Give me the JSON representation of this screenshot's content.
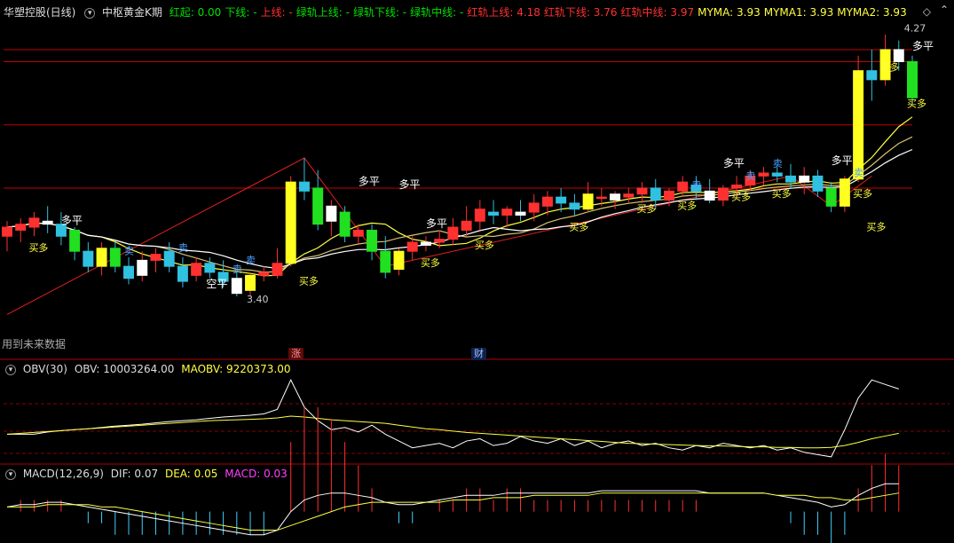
{
  "main_header": {
    "stock_name": "华塑控股(日线)",
    "indicator_name": "中枢黄金K期",
    "items": [
      {
        "label": "红起:",
        "value": "0.00",
        "color": "#00e000"
      },
      {
        "label": "下线:",
        "value": "-",
        "color": "#00e000"
      },
      {
        "label": "上线:",
        "value": "-",
        "color": "#ff3030"
      },
      {
        "label": "绿轨上线:",
        "value": "-",
        "color": "#00e000"
      },
      {
        "label": "绿轨下线:",
        "value": "-",
        "color": "#00e000"
      },
      {
        "label": "绿轨中线:",
        "value": "-",
        "color": "#00e000"
      },
      {
        "label": "红轨上线:",
        "value": "4.18",
        "color": "#ff3030"
      },
      {
        "label": "红轨下线:",
        "value": "3.76",
        "color": "#ff3030"
      },
      {
        "label": "红轨中线:",
        "value": "3.97",
        "color": "#ff3030"
      },
      {
        "label": "MYMA:",
        "value": "3.93",
        "color": "#ffff40"
      },
      {
        "label": "MYMA1:",
        "value": "3.93",
        "color": "#ffff40"
      },
      {
        "label": "MYMA2:",
        "value": "3.93",
        "color": "#ffff40"
      }
    ]
  },
  "main_footer": {
    "note": "用到未来数据",
    "tag_zhang": "涨",
    "tag_cai": "财"
  },
  "obv_header": {
    "name": "OBV(30)",
    "obv_label": "OBV:",
    "obv_value": "10003264.00",
    "maobv_label": "MAOBV:",
    "maobv_value": "9220373.00"
  },
  "macd_header": {
    "name": "MACD(12,26,9)",
    "dif_label": "DIF:",
    "dif_value": "0.07",
    "dea_label": "DEA:",
    "dea_value": "0.05",
    "macd_label": "MACD:",
    "macd_value": "0.03"
  },
  "chart_data": [
    {
      "type": "candlestick",
      "title": "华塑控股(日线)",
      "ohlc": [
        [
          3.6,
          3.65,
          3.55,
          3.63
        ],
        [
          3.62,
          3.66,
          3.58,
          3.64
        ],
        [
          3.63,
          3.68,
          3.6,
          3.66
        ],
        [
          3.65,
          3.7,
          3.61,
          3.64
        ],
        [
          3.64,
          3.68,
          3.57,
          3.6
        ],
        [
          3.62,
          3.63,
          3.52,
          3.55
        ],
        [
          3.55,
          3.58,
          3.48,
          3.5
        ],
        [
          3.5,
          3.58,
          3.47,
          3.56
        ],
        [
          3.56,
          3.58,
          3.48,
          3.5
        ],
        [
          3.5,
          3.53,
          3.44,
          3.46
        ],
        [
          3.47,
          3.55,
          3.45,
          3.52
        ],
        [
          3.52,
          3.56,
          3.48,
          3.54
        ],
        [
          3.55,
          3.58,
          3.48,
          3.5
        ],
        [
          3.5,
          3.53,
          3.43,
          3.45
        ],
        [
          3.47,
          3.53,
          3.45,
          3.51
        ],
        [
          3.51,
          3.53,
          3.46,
          3.48
        ],
        [
          3.48,
          3.52,
          3.43,
          3.45
        ],
        [
          3.46,
          3.48,
          3.4,
          3.41
        ],
        [
          3.42,
          3.48,
          3.4,
          3.47
        ],
        [
          3.47,
          3.5,
          3.45,
          3.48
        ],
        [
          3.47,
          3.56,
          3.46,
          3.51
        ],
        [
          3.51,
          3.8,
          3.5,
          3.78
        ],
        [
          3.78,
          3.86,
          3.72,
          3.75
        ],
        [
          3.76,
          3.82,
          3.62,
          3.64
        ],
        [
          3.65,
          3.72,
          3.6,
          3.7
        ],
        [
          3.68,
          3.7,
          3.58,
          3.6
        ],
        [
          3.6,
          3.64,
          3.57,
          3.62
        ],
        [
          3.62,
          3.64,
          3.52,
          3.55
        ],
        [
          3.55,
          3.6,
          3.46,
          3.48
        ],
        [
          3.49,
          3.56,
          3.47,
          3.55
        ],
        [
          3.55,
          3.6,
          3.52,
          3.58
        ],
        [
          3.57,
          3.6,
          3.55,
          3.58
        ],
        [
          3.58,
          3.62,
          3.56,
          3.59
        ],
        [
          3.59,
          3.66,
          3.57,
          3.63
        ],
        [
          3.62,
          3.7,
          3.6,
          3.65
        ],
        [
          3.65,
          3.72,
          3.62,
          3.69
        ],
        [
          3.68,
          3.72,
          3.64,
          3.67
        ],
        [
          3.67,
          3.7,
          3.63,
          3.69
        ],
        [
          3.68,
          3.72,
          3.65,
          3.67
        ],
        [
          3.68,
          3.74,
          3.65,
          3.71
        ],
        [
          3.7,
          3.75,
          3.67,
          3.73
        ],
        [
          3.73,
          3.76,
          3.68,
          3.71
        ],
        [
          3.71,
          3.74,
          3.67,
          3.69
        ],
        [
          3.69,
          3.78,
          3.68,
          3.74
        ],
        [
          3.73,
          3.76,
          3.7,
          3.73
        ],
        [
          3.72,
          3.75,
          3.69,
          3.74
        ],
        [
          3.73,
          3.76,
          3.71,
          3.74
        ],
        [
          3.74,
          3.78,
          3.71,
          3.76
        ],
        [
          3.76,
          3.79,
          3.69,
          3.72
        ],
        [
          3.72,
          3.76,
          3.7,
          3.75
        ],
        [
          3.75,
          3.8,
          3.73,
          3.78
        ],
        [
          3.77,
          3.8,
          3.72,
          3.75
        ],
        [
          3.75,
          3.79,
          3.71,
          3.72
        ],
        [
          3.72,
          3.77,
          3.7,
          3.76
        ],
        [
          3.76,
          3.8,
          3.73,
          3.77
        ],
        [
          3.77,
          3.82,
          3.75,
          3.8
        ],
        [
          3.8,
          3.83,
          3.77,
          3.81
        ],
        [
          3.81,
          3.83,
          3.78,
          3.8
        ],
        [
          3.8,
          3.84,
          3.76,
          3.78
        ],
        [
          3.78,
          3.83,
          3.74,
          3.8
        ],
        [
          3.8,
          3.82,
          3.73,
          3.75
        ],
        [
          3.76,
          3.78,
          3.68,
          3.7
        ],
        [
          3.7,
          3.8,
          3.68,
          3.79
        ],
        [
          3.79,
          4.2,
          3.78,
          4.15
        ],
        [
          4.15,
          4.22,
          4.05,
          4.12
        ],
        [
          4.12,
          4.27,
          4.1,
          4.22
        ],
        [
          4.22,
          4.25,
          4.15,
          4.18
        ],
        [
          4.18,
          4.2,
          4.04,
          4.06
        ]
      ],
      "annotations": [
        "买多",
        "多平",
        "空平",
        "卖",
        "3.40",
        "4.27"
      ],
      "price_lines": [
        4.18,
        3.97,
        3.76
      ]
    },
    {
      "type": "line",
      "title": "OBV(30)",
      "series": [
        {
          "name": "OBV",
          "values": [
            9.0,
            9.0,
            9.0,
            9.05,
            9.08,
            9.1,
            9.12,
            9.15,
            9.18,
            9.2,
            9.22,
            9.25,
            9.28,
            9.3,
            9.32,
            9.35,
            9.38,
            9.4,
            9.42,
            9.45,
            9.55,
            10.2,
            9.6,
            9.3,
            9.1,
            9.15,
            9.05,
            9.2,
            9.0,
            8.85,
            8.7,
            8.75,
            8.8,
            8.7,
            8.85,
            8.9,
            8.75,
            8.8,
            8.95,
            8.85,
            8.8,
            8.9,
            8.75,
            8.85,
            8.7,
            8.8,
            8.85,
            8.75,
            8.8,
            8.7,
            8.65,
            8.75,
            8.7,
            8.8,
            8.75,
            8.7,
            8.75,
            8.65,
            8.7,
            8.6,
            8.55,
            8.5,
            9.1,
            9.8,
            10.2,
            10.1,
            10.0
          ]
        },
        {
          "name": "MAOBV",
          "values": [
            9.0,
            9.02,
            9.04,
            9.06,
            9.08,
            9.1,
            9.12,
            9.14,
            9.16,
            9.18,
            9.2,
            9.22,
            9.24,
            9.26,
            9.28,
            9.3,
            9.31,
            9.32,
            9.33,
            9.34,
            9.36,
            9.4,
            9.38,
            9.35,
            9.32,
            9.3,
            9.28,
            9.26,
            9.24,
            9.2,
            9.16,
            9.12,
            9.1,
            9.07,
            9.04,
            9.02,
            9.0,
            8.98,
            8.96,
            8.94,
            8.92,
            8.9,
            8.88,
            8.86,
            8.84,
            8.82,
            8.8,
            8.79,
            8.78,
            8.77,
            8.76,
            8.75,
            8.74,
            8.74,
            8.73,
            8.72,
            8.72,
            8.71,
            8.71,
            8.7,
            8.7,
            8.71,
            8.75,
            8.82,
            8.9,
            8.96,
            9.02
          ]
        }
      ]
    },
    {
      "type": "line",
      "title": "MACD(12,26,9)",
      "series": [
        {
          "name": "DIF",
          "values": [
            0.02,
            0.03,
            0.03,
            0.04,
            0.04,
            0.03,
            0.02,
            0.01,
            0.0,
            -0.01,
            -0.02,
            -0.03,
            -0.04,
            -0.05,
            -0.06,
            -0.07,
            -0.08,
            -0.09,
            -0.1,
            -0.1,
            -0.08,
            0.0,
            0.05,
            0.07,
            0.08,
            0.08,
            0.07,
            0.06,
            0.04,
            0.03,
            0.03,
            0.04,
            0.05,
            0.06,
            0.07,
            0.07,
            0.07,
            0.08,
            0.08,
            0.08,
            0.08,
            0.08,
            0.08,
            0.08,
            0.09,
            0.09,
            0.09,
            0.09,
            0.09,
            0.09,
            0.09,
            0.09,
            0.08,
            0.08,
            0.08,
            0.08,
            0.08,
            0.07,
            0.06,
            0.05,
            0.04,
            0.02,
            0.03,
            0.07,
            0.1,
            0.12,
            0.12
          ]
        },
        {
          "name": "DEA",
          "values": [
            0.02,
            0.02,
            0.02,
            0.03,
            0.03,
            0.03,
            0.03,
            0.02,
            0.02,
            0.01,
            0.0,
            -0.01,
            -0.02,
            -0.03,
            -0.04,
            -0.05,
            -0.06,
            -0.07,
            -0.08,
            -0.08,
            -0.08,
            -0.06,
            -0.04,
            -0.02,
            0.0,
            0.02,
            0.03,
            0.04,
            0.04,
            0.04,
            0.04,
            0.04,
            0.04,
            0.05,
            0.05,
            0.05,
            0.06,
            0.06,
            0.06,
            0.07,
            0.07,
            0.07,
            0.07,
            0.07,
            0.08,
            0.08,
            0.08,
            0.08,
            0.08,
            0.08,
            0.08,
            0.08,
            0.08,
            0.08,
            0.08,
            0.08,
            0.08,
            0.07,
            0.07,
            0.07,
            0.06,
            0.06,
            0.05,
            0.05,
            0.06,
            0.07,
            0.08
          ]
        }
      ]
    }
  ]
}
